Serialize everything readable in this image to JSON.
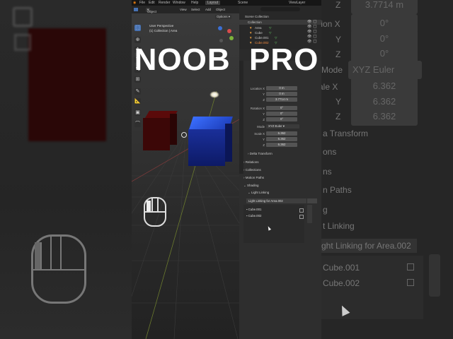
{
  "overlay": {
    "left_word": "NOOB",
    "right_word": "PRO"
  },
  "topbar": {
    "menus": [
      "File",
      "Edit",
      "Render",
      "Window",
      "Help"
    ],
    "workspace": "Layout",
    "scene_label": "Scene",
    "viewlayer_label": "ViewLayer"
  },
  "viewport_header": {
    "mode": "Object Mode",
    "menus": [
      "View",
      "Select",
      "Add",
      "Object"
    ],
    "options": "Options",
    "perspective": "User Perspective",
    "collection_info": "(1) Collection | Area"
  },
  "outliner": {
    "search_placeholder": "",
    "root": "Scene Collection",
    "collection": "Collection",
    "items": [
      "Area",
      "Cube",
      "Cube.001",
      "Cube.002"
    ]
  },
  "properties": {
    "location": {
      "label": "Location X",
      "x": "0 m",
      "y": "0 m",
      "z": "3.7714 m"
    },
    "rotation": {
      "label": "Rotation X",
      "x": "0°",
      "y": "0°",
      "z": "0°"
    },
    "mode": {
      "label": "Mode",
      "value": "XYZ Euler"
    },
    "scale": {
      "label": "Scale X",
      "x": "6.362",
      "y": "6.362",
      "z": "6.362"
    },
    "axis_y": "Y",
    "axis_z": "Z",
    "sections": [
      "Delta Transform",
      "Relations",
      "Collections",
      "Motion Paths",
      "Shading"
    ],
    "light_linking_header": "Light Linking",
    "light_linking_collection": "Light Linking for Area.002",
    "linked_items": [
      "Cube.001",
      "Cube.002"
    ]
  },
  "right_zoom": {
    "z_value": "3.7714 m",
    "x_label": "tion X",
    "y_label": "Y",
    "z_label": "Z",
    "rot_values": [
      "0°",
      "0°",
      "0°"
    ],
    "mode_label": "Mode",
    "mode_value": "XYZ Euler",
    "scale_label": "ale X",
    "scale_values": [
      "6.362",
      "6.362",
      "6.362"
    ],
    "sections": [
      "a Transform",
      "ons",
      "ns",
      "n Paths",
      "g",
      "t Linking"
    ],
    "ll_collection": "ght Linking for Area.002",
    "items": [
      "Cube.001",
      "Cube.002"
    ]
  },
  "left_zoom": {}
}
